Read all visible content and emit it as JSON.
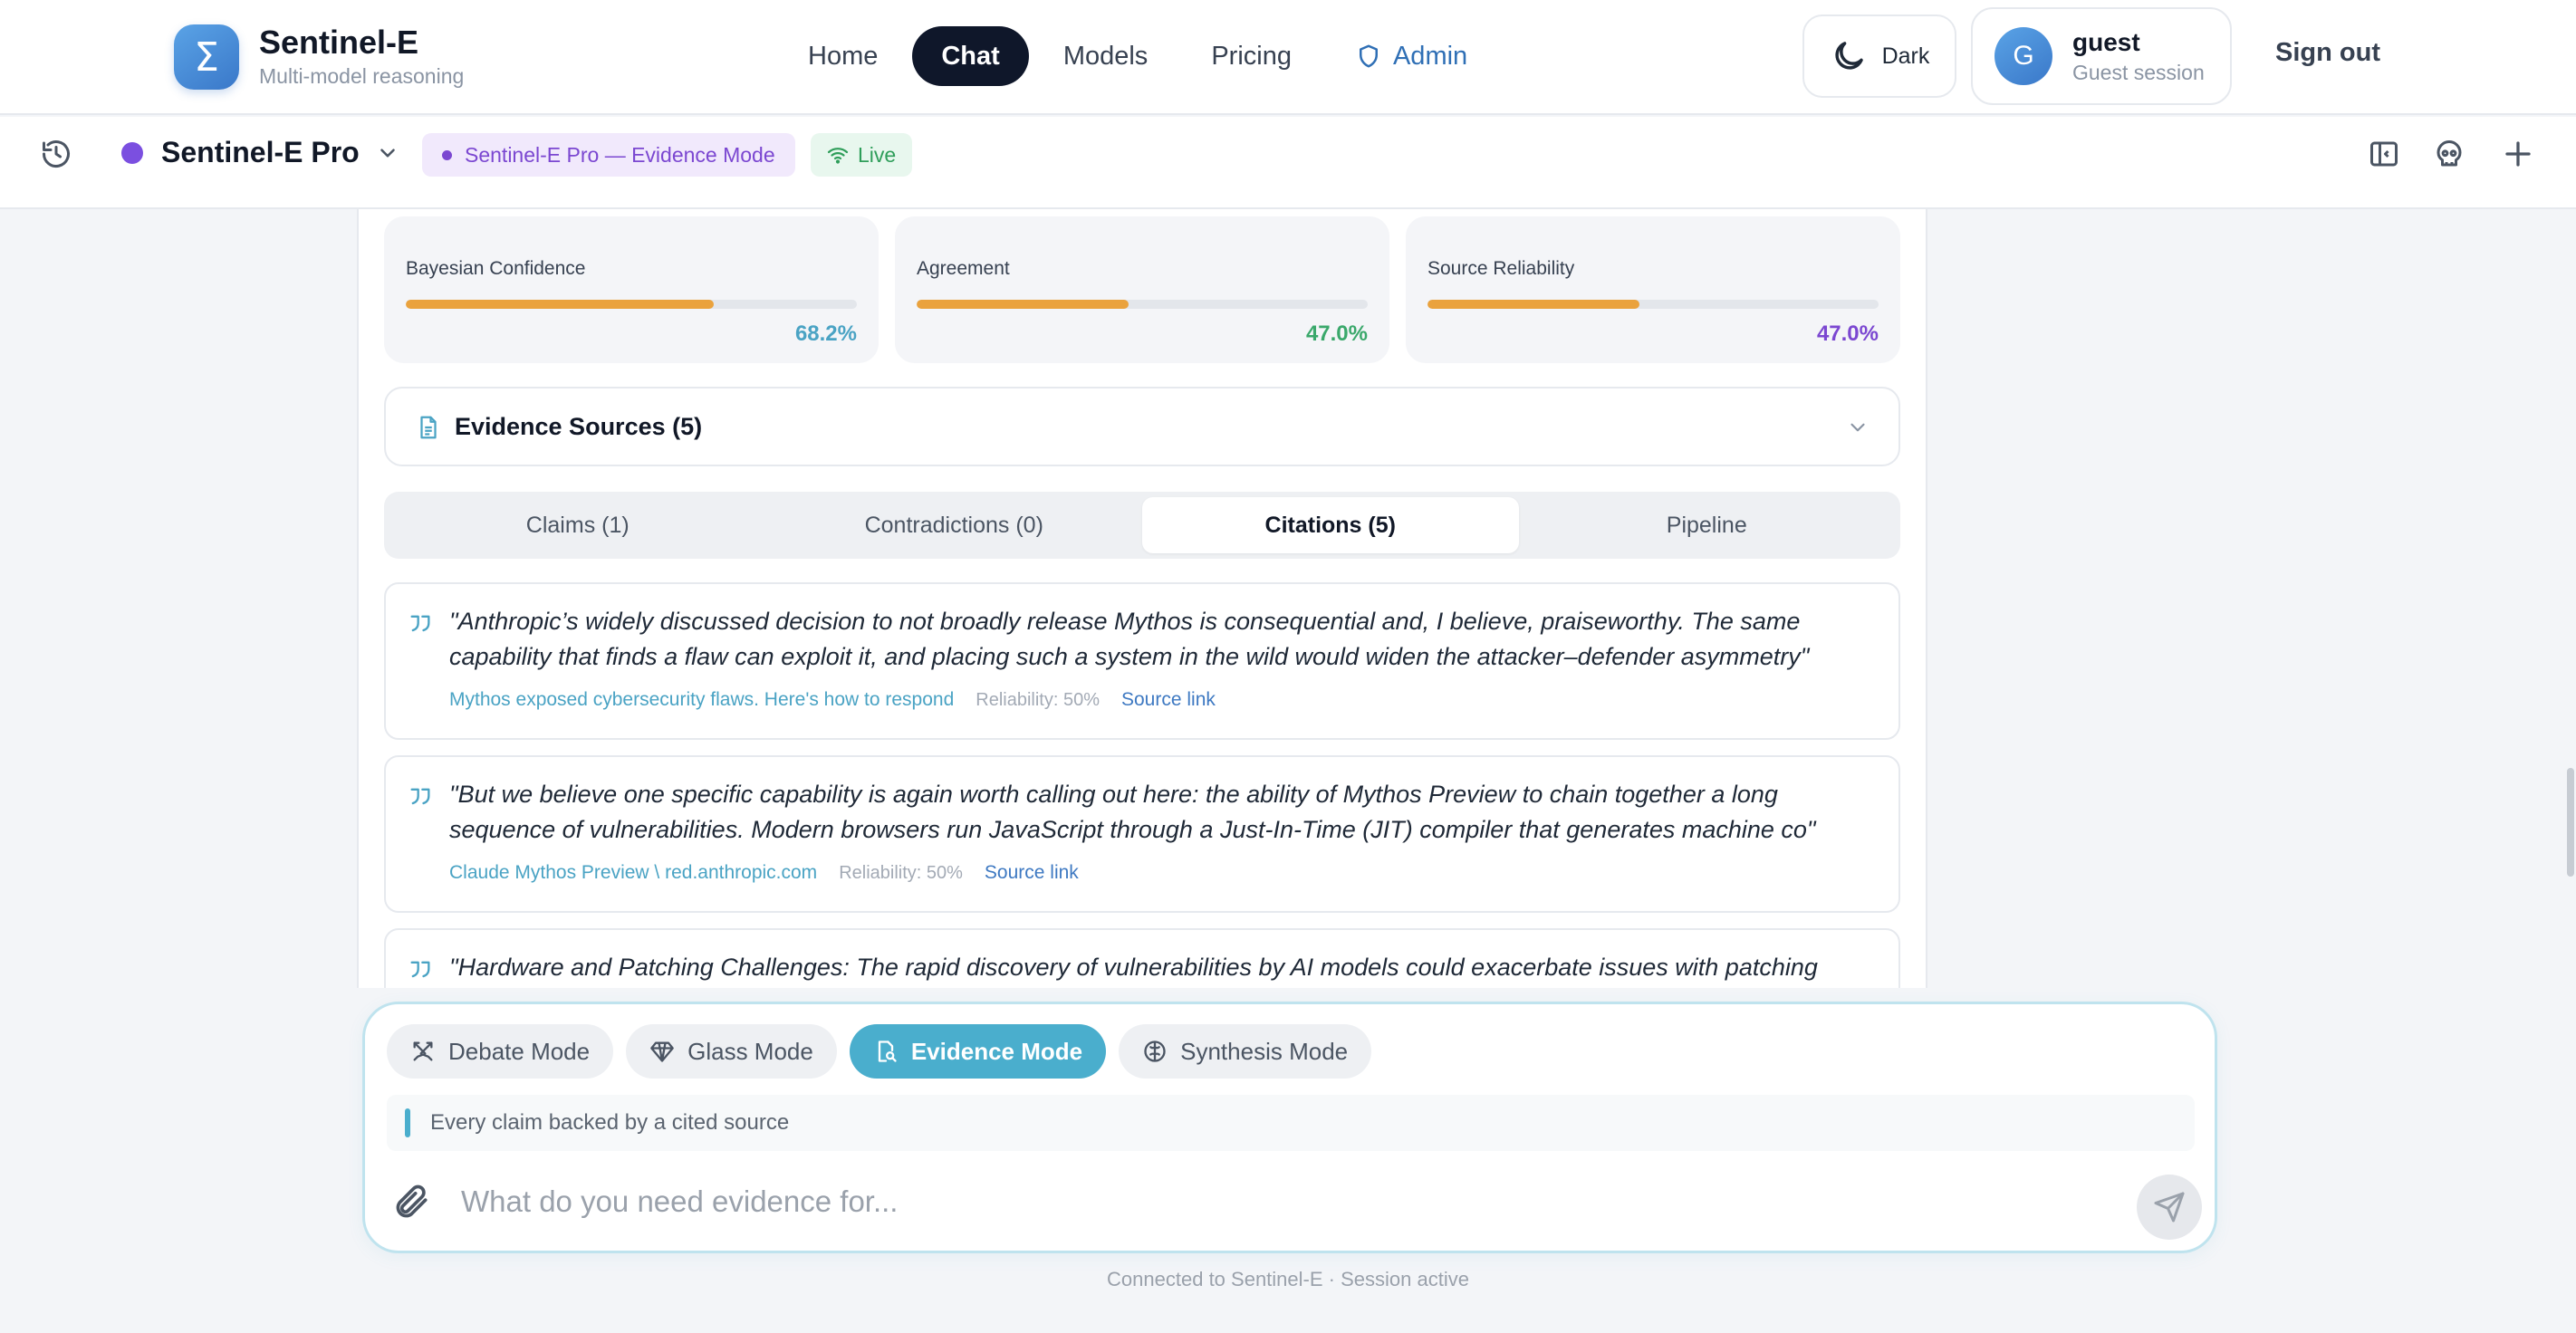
{
  "brand": {
    "logo_glyph": "Σ",
    "name": "Sentinel-E",
    "subtitle": "Multi-model reasoning"
  },
  "nav": {
    "home": "Home",
    "chat": "Chat",
    "models": "Models",
    "pricing": "Pricing",
    "admin": "Admin",
    "active": "Chat"
  },
  "theme_toggle": {
    "label": "Dark",
    "icon": "moon-icon"
  },
  "user": {
    "initial": "G",
    "name": "guest",
    "session": "Guest session"
  },
  "sign_out": "Sign out",
  "subheader": {
    "model_name": "Sentinel-E Pro",
    "mode_badge": "Sentinel-E Pro — Evidence Mode",
    "live_badge": "Live",
    "colors": {
      "model_dot": "#7b4fe0",
      "live": "#2f9e5a"
    }
  },
  "metrics": [
    {
      "label": "Bayesian Confidence",
      "value_text": "68.2%",
      "fraction": 0.682,
      "value_color": "#4aa3c4"
    },
    {
      "label": "Agreement",
      "value_text": "47.0%",
      "fraction": 0.47,
      "value_color": "#3aa86b"
    },
    {
      "label": "Source Reliability",
      "value_text": "47.0%",
      "fraction": 0.47,
      "value_color": "#7b47d1"
    }
  ],
  "evidence_sources": {
    "title": "Evidence Sources (5)"
  },
  "tabs": [
    {
      "label": "Claims (1)",
      "active": false
    },
    {
      "label": "Contradictions (0)",
      "active": false
    },
    {
      "label": "Citations (5)",
      "active": true
    },
    {
      "label": "Pipeline",
      "active": false
    }
  ],
  "citations": [
    {
      "quote": "\"Anthropic’s widely discussed decision to not broadly release Mythos is consequential and, I believe, praiseworthy. The same capability that finds a flaw can exploit it, and placing such a system in the wild would widen the attacker–defender asymmetry\"",
      "source": "Mythos exposed cybersecurity flaws. Here's how to respond",
      "reliability": "Reliability: 50%",
      "link": "Source link"
    },
    {
      "quote": "\"But we believe one specific capability is again worth calling out here: the ability of Mythos Preview to chain together a long sequence of vulnerabilities. Modern browsers run JavaScript through a Just-In-Time (JIT) compiler that generates machine co\"",
      "source": "Claude Mythos Preview \\ red.anthropic.com",
      "reliability": "Reliability: 50%",
      "link": "Source link"
    },
    {
      "quote": "\"Hardware and Patching Challenges: The rapid discovery of vulnerabilities by AI models could exacerbate issues with patching",
      "source": "",
      "reliability": "",
      "link": ""
    }
  ],
  "composer": {
    "modes": [
      {
        "label": "Debate Mode",
        "icon": "swords-icon",
        "active": false
      },
      {
        "label": "Glass Mode",
        "icon": "diamond-icon",
        "active": false
      },
      {
        "label": "Evidence Mode",
        "icon": "document-search-icon",
        "active": true
      },
      {
        "label": "Synthesis Mode",
        "icon": "brain-icon",
        "active": false
      }
    ],
    "hint": "Every claim backed by a cited source",
    "placeholder": "What do you need evidence for...",
    "value": ""
  },
  "footer": "Connected to Sentinel-E · Session active",
  "colors": {
    "accent": "#4aaecd",
    "bar_fill": "#eaa23d",
    "nav_active_bg": "#0f172a"
  }
}
